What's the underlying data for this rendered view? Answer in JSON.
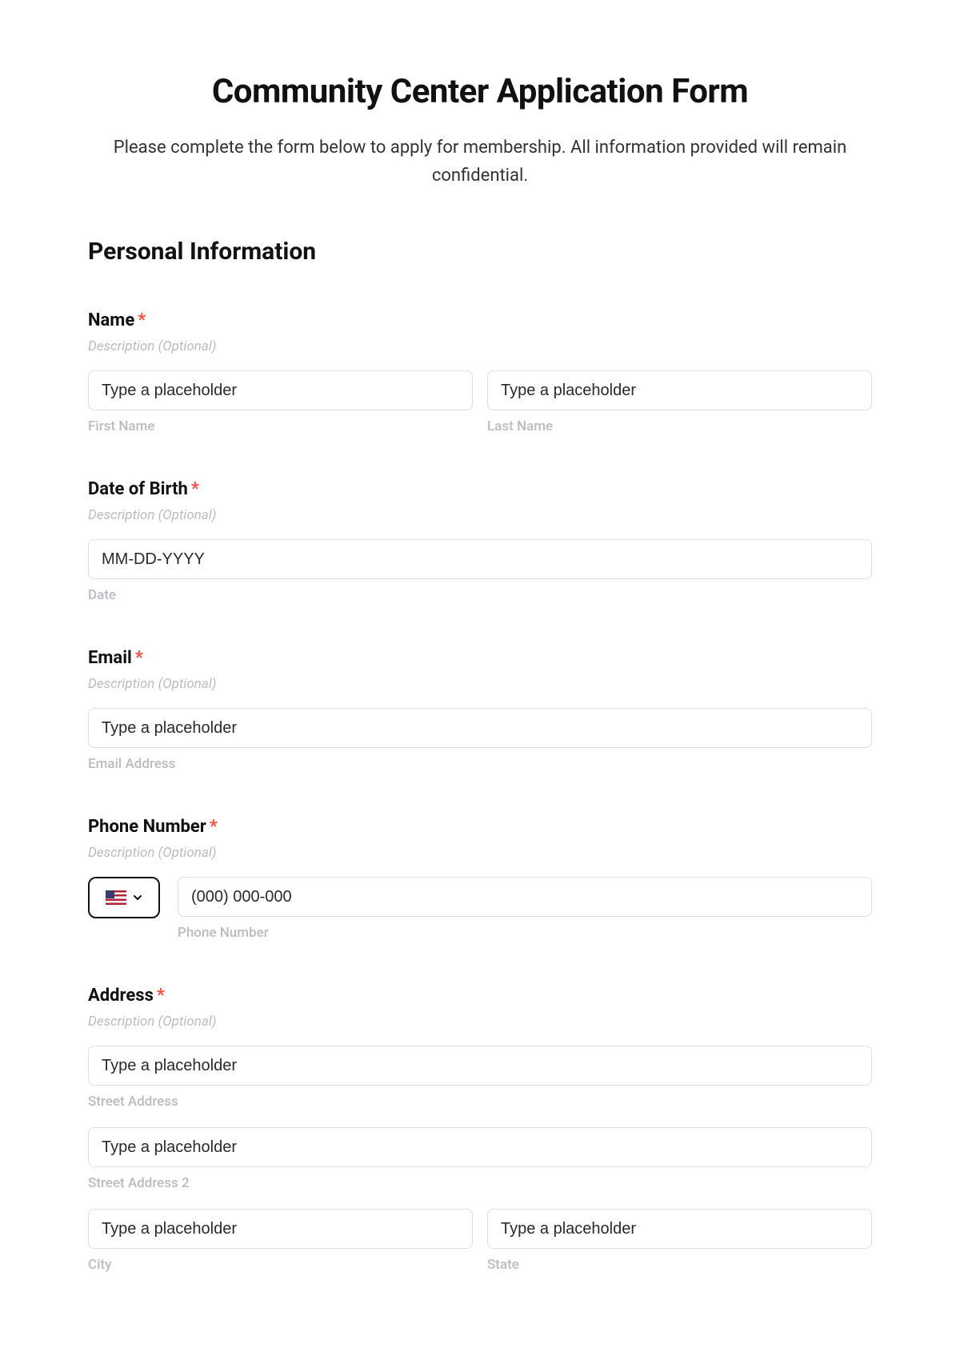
{
  "title": "Community Center Application Form",
  "subtitle": "Please complete the form below to apply for membership. All information provided will remain confidential.",
  "section": "Personal Information",
  "common": {
    "description_optional": "Description (Optional)",
    "placeholder": "Type a placeholder",
    "required_star": "*"
  },
  "fields": {
    "name": {
      "label": "Name",
      "first_sub": "First Name",
      "last_sub": "Last Name"
    },
    "dob": {
      "label": "Date of Birth",
      "placeholder": "MM-DD-YYYY",
      "sub": "Date"
    },
    "email": {
      "label": "Email",
      "sub": "Email Address"
    },
    "phone": {
      "label": "Phone Number",
      "placeholder": "(000) 000-000",
      "sub": "Phone Number"
    },
    "address": {
      "label": "Address",
      "street_sub": "Street Address",
      "street2_sub": "Street Address 2",
      "city_sub": "City",
      "state_sub": "State"
    }
  }
}
